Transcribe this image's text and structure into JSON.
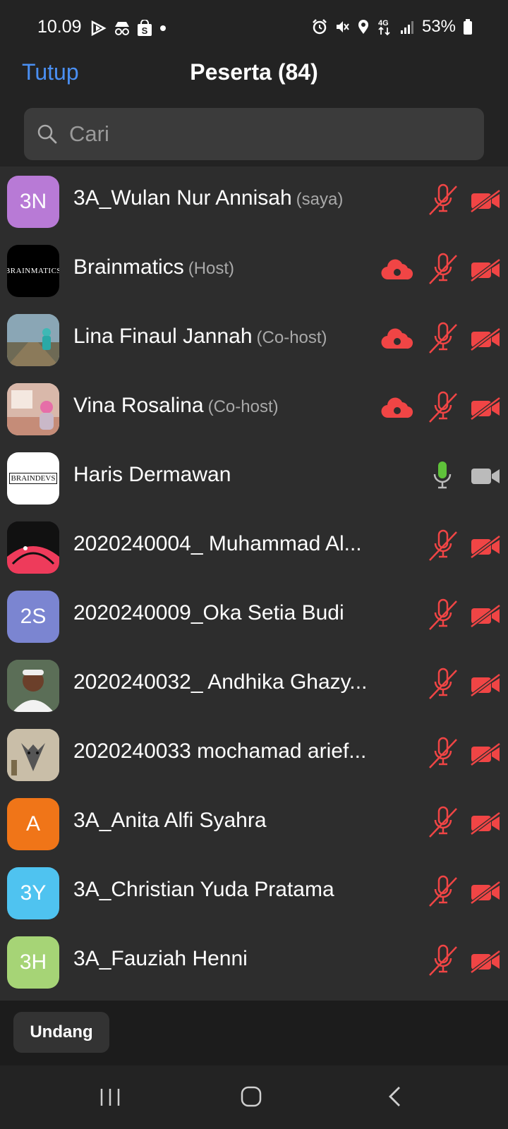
{
  "status_bar": {
    "time": "10.09",
    "battery": "53%",
    "network": "4G"
  },
  "header": {
    "close_label": "Tutup",
    "title": "Peserta (84)"
  },
  "search": {
    "placeholder": "Cari"
  },
  "participants": [
    {
      "name": "3A_Wulan Nur Annisah",
      "role": "(saya)",
      "avatar_text": "3N",
      "avatar_color": "#b87ad6",
      "recording": false,
      "mic": "muted",
      "camera": "off"
    },
    {
      "name": "Brainmatics",
      "role": "(Host)",
      "avatar_text": "BRAINMATICS",
      "avatar_color": "#000000",
      "recording": true,
      "mic": "muted",
      "camera": "off"
    },
    {
      "name": "Lina Finaul Jannah",
      "role": "(Co-host)",
      "avatar_text": "",
      "avatar_color": "#8aa6b5",
      "recording": true,
      "mic": "muted",
      "camera": "off"
    },
    {
      "name": "Vina Rosalina",
      "role": "(Co-host)",
      "avatar_text": "",
      "avatar_color": "#d9b8aa",
      "recording": true,
      "mic": "muted",
      "camera": "off"
    },
    {
      "name": "Haris Dermawan",
      "role": "",
      "avatar_text": "BRAINDEVS",
      "avatar_color": "#ffffff",
      "recording": false,
      "mic": "active",
      "camera": "on"
    },
    {
      "name": "2020240004_ Muhammad Al...",
      "role": "",
      "avatar_text": "",
      "avatar_color": "#1a0f1f",
      "recording": false,
      "mic": "muted",
      "camera": "off"
    },
    {
      "name": "2020240009_Oka Setia Budi",
      "role": "",
      "avatar_text": "2S",
      "avatar_color": "#7b85d1",
      "recording": false,
      "mic": "muted",
      "camera": "off"
    },
    {
      "name": "2020240032_ Andhika Ghazy...",
      "role": "",
      "avatar_text": "",
      "avatar_color": "#5b6e57",
      "recording": false,
      "mic": "muted",
      "camera": "off"
    },
    {
      "name": "2020240033 mochamad arief...",
      "role": "",
      "avatar_text": "",
      "avatar_color": "#c9bea8",
      "recording": false,
      "mic": "muted",
      "camera": "off"
    },
    {
      "name": "3A_Anita Alfi Syahra",
      "role": "",
      "avatar_text": "A",
      "avatar_color": "#f07518",
      "recording": false,
      "mic": "muted",
      "camera": "off"
    },
    {
      "name": "3A_Christian Yuda Pratama",
      "role": "",
      "avatar_text": "3Y",
      "avatar_color": "#4fc3f0",
      "recording": false,
      "mic": "muted",
      "camera": "off"
    },
    {
      "name": "3A_Fauziah Henni",
      "role": "",
      "avatar_text": "3H",
      "avatar_color": "#a6d476",
      "recording": false,
      "mic": "muted",
      "camera": "off"
    }
  ],
  "footer": {
    "invite_label": "Undang"
  },
  "colors": {
    "accent": "#4a8ff2",
    "muted_red": "#f04545",
    "mic_active": "#5fc23a"
  }
}
